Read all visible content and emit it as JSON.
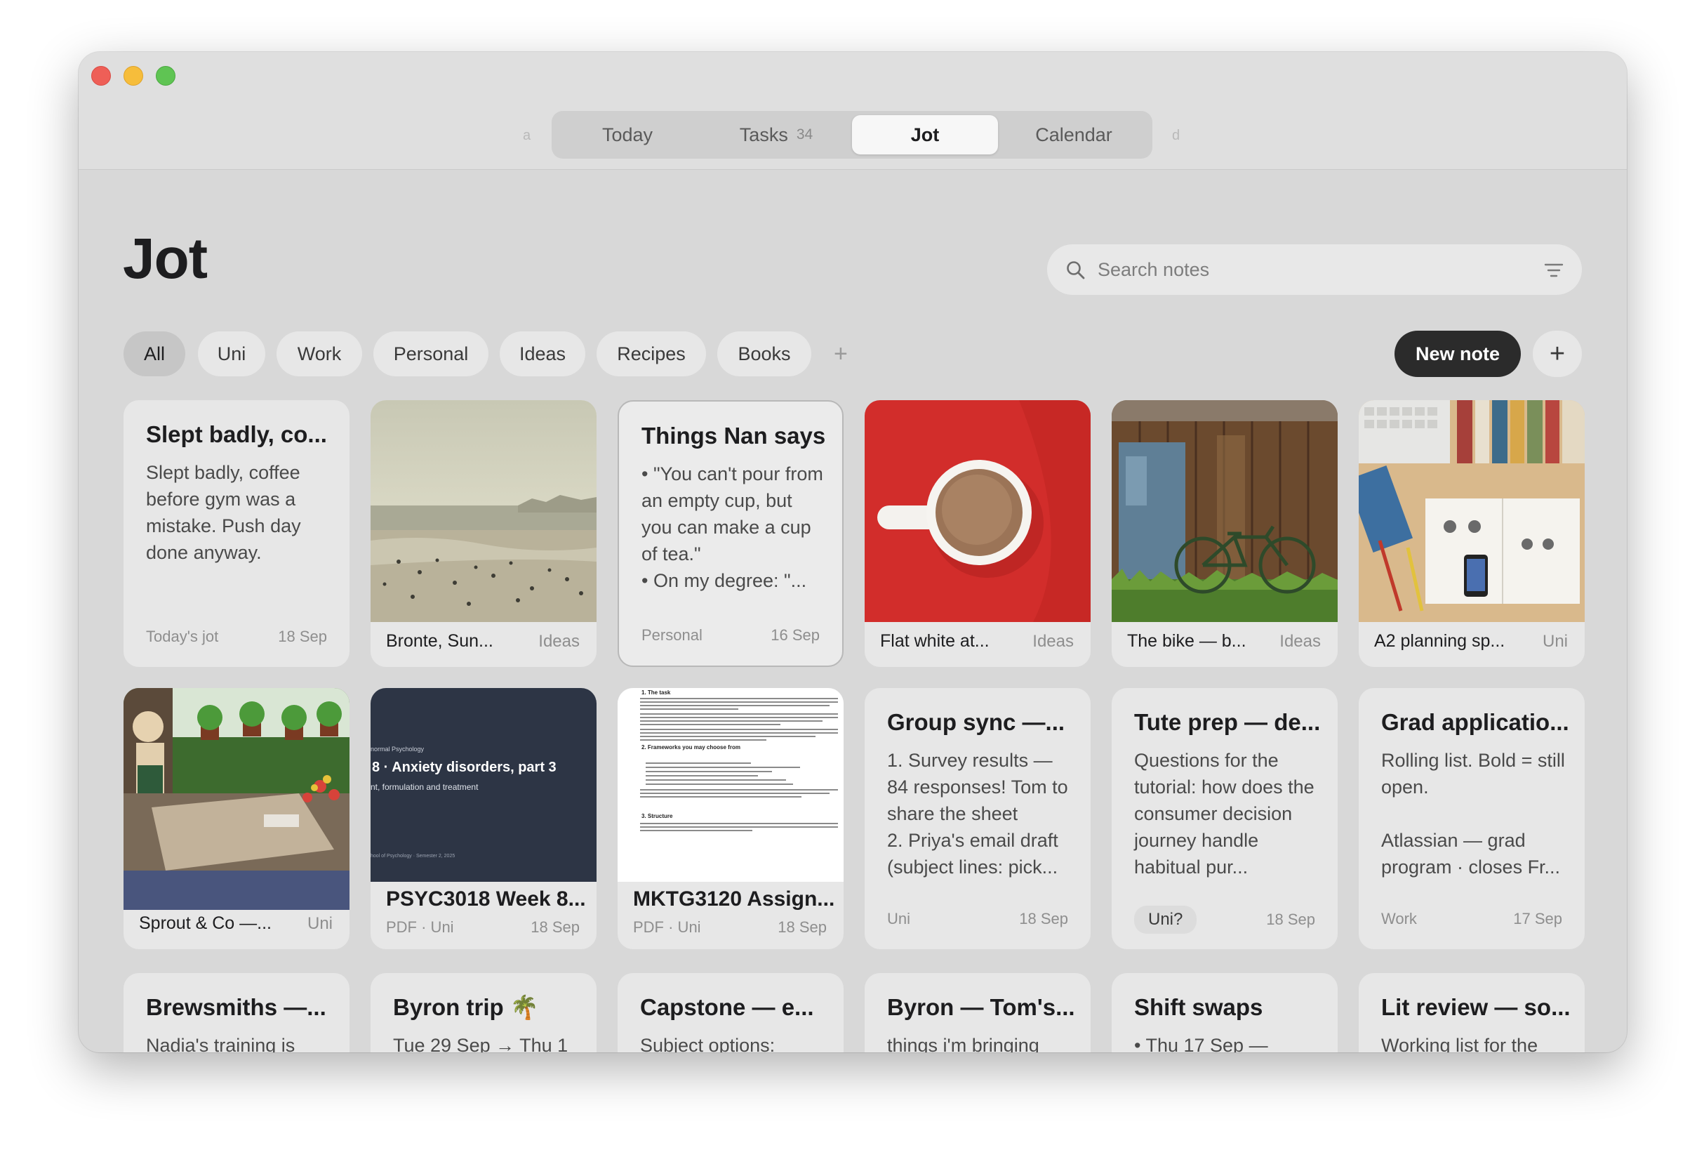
{
  "nav": {
    "hint_left": "a",
    "hint_right": "d",
    "tabs": [
      {
        "label": "Today"
      },
      {
        "label": "Tasks",
        "count": "34"
      },
      {
        "label": "Jot"
      },
      {
        "label": "Calendar"
      }
    ],
    "active_tab": "Jot"
  },
  "page": {
    "title": "Jot"
  },
  "search": {
    "placeholder": "Search notes"
  },
  "filters": [
    "All",
    "Uni",
    "Work",
    "Personal",
    "Ideas",
    "Recipes",
    "Books"
  ],
  "actions": {
    "add_filter": "+",
    "new_note": "New note",
    "add": "+"
  },
  "cards_row1": [
    {
      "title": "Slept badly, co...",
      "body": "Slept badly, coffee before gym was a mistake. Push day done anyway.",
      "tag": "Today's jot",
      "date": "18 Sep"
    },
    {
      "name": "Bronte, Sun...",
      "tag": "Ideas"
    },
    {
      "title": "Things Nan says",
      "body": "• \"You can't pour from an empty cup, but you can make a cup of tea.\"\n• On my degree: \"...",
      "tag": "Personal",
      "date": "16 Sep"
    },
    {
      "name": "Flat white at...",
      "tag": "Ideas"
    },
    {
      "name": "The bike — b...",
      "tag": "Ideas"
    },
    {
      "name": "A2 planning sp...",
      "tag": "Uni"
    }
  ],
  "cards_row2": [
    {
      "name": "Sprout & Co —...",
      "tag": "Uni"
    },
    {
      "title": "PSYC3018 Week 8...",
      "meta": "PDF · Uni",
      "date": "18 Sep",
      "slide": {
        "course": "normal Psychology",
        "heading": "8 · Anxiety disorders, part 3",
        "sub": "nt, formulation and treatment",
        "footer": "hool of Psychology · Semester 2, 2025"
      }
    },
    {
      "title": "MKTG3120 Assign...",
      "meta": "PDF · Uni",
      "date": "18 Sep",
      "doc": {
        "h1": "1. The task",
        "h2": "2. Frameworks you may choose from",
        "h3": "3. Structure"
      }
    },
    {
      "title": "Group sync —...",
      "body": "1. Survey results — 84 responses! Tom to share the sheet\n2. Priya's email draft (subject lines: pick...",
      "tag": "Uni",
      "date": "18 Sep"
    },
    {
      "title": "Tute prep — de...",
      "body": "Questions for the tutorial: how does the consumer decision journey handle habitual pur...",
      "tag": "Uni?",
      "date": "18 Sep"
    },
    {
      "title": "Grad applicatio...",
      "body": "Rolling list. Bold = still open.\n\nAtlassian — grad program · closes Fr...",
      "tag": "Work",
      "date": "17 Sep"
    }
  ],
  "cards_row3": [
    {
      "title": "Brewsmiths —...",
      "body": "Nadia's training is"
    },
    {
      "title": "Byron trip 🌴",
      "body": "Tue 29 Sep → Thu 1"
    },
    {
      "title": "Capstone — e...",
      "body": "Subject options:"
    },
    {
      "title": "Byron — Tom's...",
      "body": "things i'm bringing"
    },
    {
      "title": "Shift swaps",
      "body": "• Thu 17 Sep —"
    },
    {
      "title": "Lit review — so...",
      "body": "Working list for the"
    }
  ],
  "colors": {
    "accent_dark": "#2b2b2b",
    "window_bg": "#d8d8d8",
    "card_bg": "#e7e7e7"
  }
}
